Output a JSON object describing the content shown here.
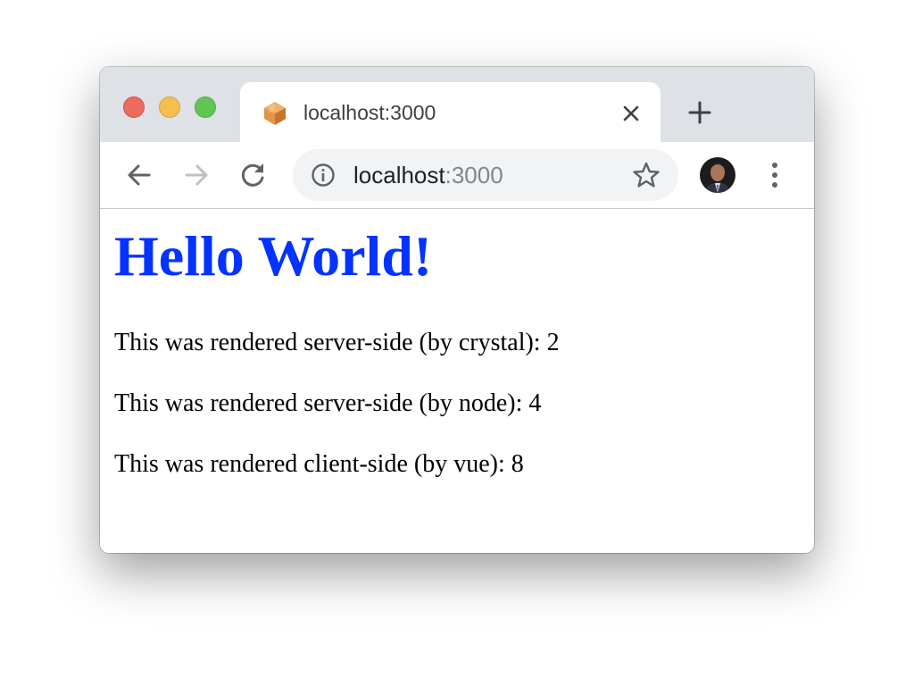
{
  "browser": {
    "tab": {
      "title": "localhost:3000",
      "favicon": "crystal-icon"
    },
    "address_bar": {
      "host": "localhost",
      "port": ":3000"
    },
    "toolbar_icons": [
      "back-arrow-icon",
      "forward-arrow-icon",
      "reload-icon",
      "info-icon",
      "star-icon",
      "avatar",
      "more-vert-icon"
    ],
    "colors": {
      "tabstrip": "#dee1e6",
      "omnibox": "#f1f3f4",
      "close": "#ec6a5e",
      "minimize": "#f4bf4f",
      "maximize": "#61c554"
    }
  },
  "page": {
    "heading": "Hello World!",
    "heading_color": "#0433ff",
    "lines": [
      "This was rendered server-side (by crystal): 2",
      "This was rendered server-side (by node): 4",
      "This was rendered client-side (by vue): 8"
    ]
  }
}
